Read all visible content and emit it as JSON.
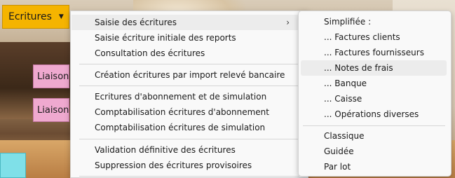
{
  "toolbar": {
    "ecritures_label": "Ecritures",
    "caret_icon": "▼",
    "liaison_labels": [
      "Liaison",
      "Liaison"
    ]
  },
  "menu": {
    "items": [
      "Saisie des écritures",
      "Saisie écriture initiale des reports",
      "Consultation des écritures",
      "Création écritures par import relevé bancaire",
      "Ecritures d'abonnement et de simulation",
      "Comptabilisation écritures d'abonnement",
      "Comptabilisation écritures de simulation",
      "Validation définitive des écritures",
      "Suppression des écritures provisoires"
    ],
    "submenu_arrow": "›"
  },
  "submenu": {
    "items": [
      "Simplifiée :",
      "... Factures clients",
      "... Factures fournisseurs",
      "... Notes de frais",
      "... Banque",
      "... Caisse",
      "... Opérations diverses",
      "Classique",
      "Guidée",
      "Par lot"
    ]
  },
  "colors": {
    "ecritures_button": "#f5b400",
    "liaison_button": "#efa9cf",
    "highlight": "#ececec"
  }
}
